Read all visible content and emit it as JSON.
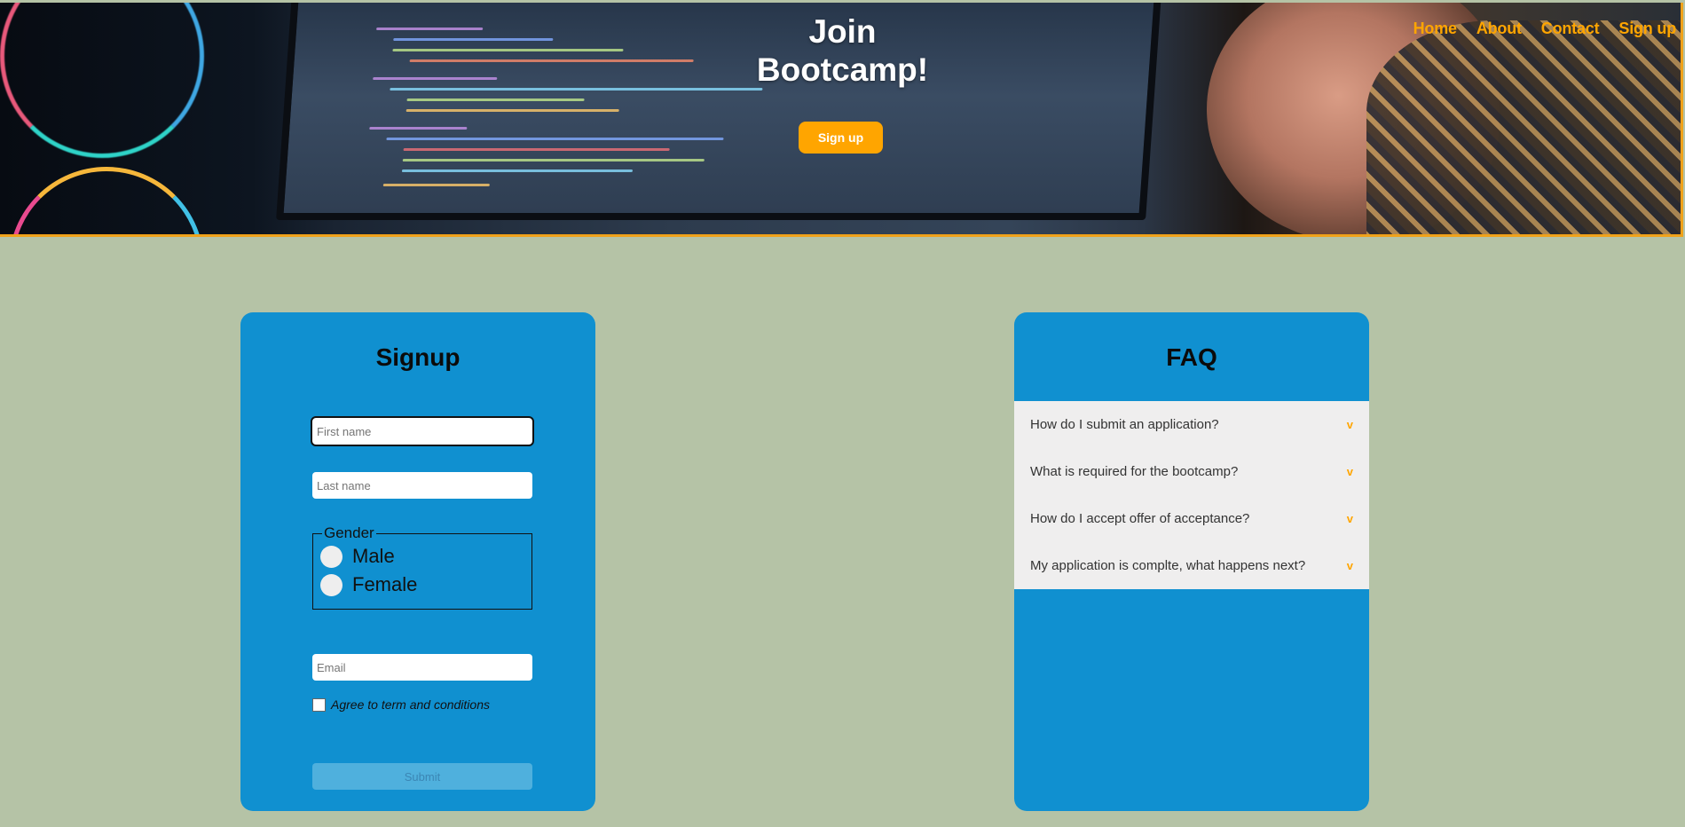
{
  "hero": {
    "title_line1": "Join",
    "title_line2": "Bootcamp!",
    "cta_label": "Sign up"
  },
  "nav": {
    "items": [
      {
        "label": "Home"
      },
      {
        "label": "About"
      },
      {
        "label": "Contact"
      },
      {
        "label": "Sign up"
      }
    ]
  },
  "signup": {
    "title": "Signup",
    "first_name_placeholder": "First name",
    "last_name_placeholder": "Last name",
    "gender_legend": "Gender",
    "gender_options": [
      {
        "label": "Male"
      },
      {
        "label": "Female"
      }
    ],
    "email_placeholder": "Email",
    "terms_label": "Agree to term and conditions",
    "submit_label": "Submit"
  },
  "faq": {
    "title": "FAQ",
    "items": [
      {
        "question": "How do I submit an application?",
        "chevron": "v"
      },
      {
        "question": "What is required for the bootcamp?",
        "chevron": "v"
      },
      {
        "question": "How do I accept offer of acceptance?",
        "chevron": "v"
      },
      {
        "question": "My application is complte, what happens next?",
        "chevron": "v"
      }
    ]
  },
  "colors": {
    "background": "#b5c3a6",
    "card": "#1090d0",
    "accent": "#ffa500",
    "faq_list_bg": "#efeeee"
  }
}
